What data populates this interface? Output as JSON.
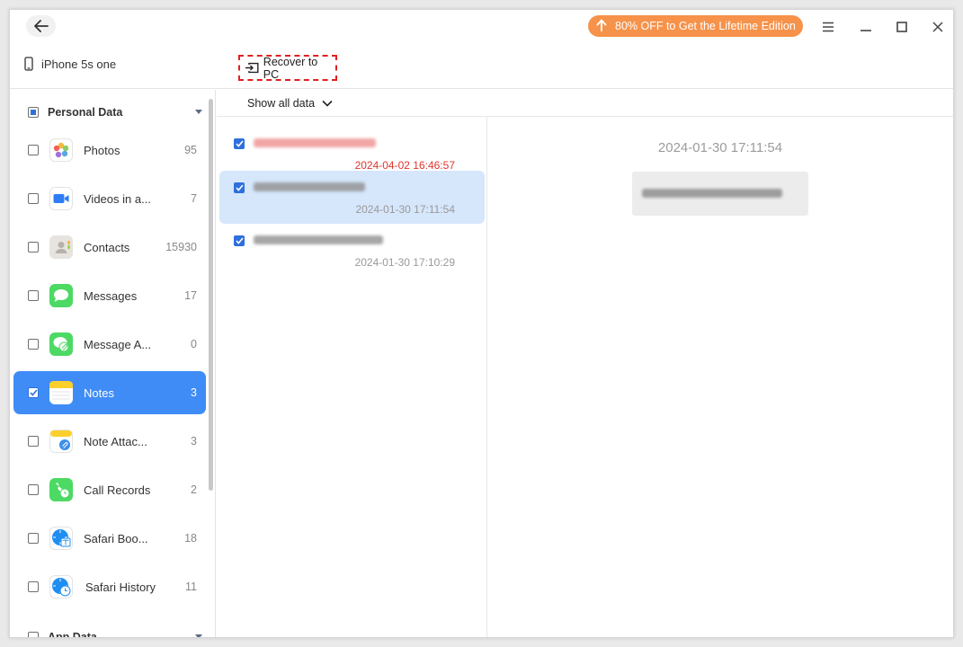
{
  "header": {
    "promo_label": "80% OFF to Get the Lifetime Edition",
    "device_name": "iPhone 5s one",
    "recover_label": "Recover to PC",
    "promo_color": "#f7924a"
  },
  "sidebar": {
    "group_personal": "Personal Data",
    "group_app": "App Data",
    "items": [
      {
        "name": "Photos",
        "count": "95",
        "icon": "photos-icon"
      },
      {
        "name": "Videos in a...",
        "count": "7",
        "icon": "videos-icon"
      },
      {
        "name": "Contacts",
        "count": "15930",
        "icon": "contacts-icon"
      },
      {
        "name": "Messages",
        "count": "17",
        "icon": "messages-icon"
      },
      {
        "name": "Message A...",
        "count": "0",
        "icon": "message-attachments-icon"
      },
      {
        "name": "Notes",
        "count": "3",
        "icon": "notes-icon"
      },
      {
        "name": "Note Attac...",
        "count": "3",
        "icon": "note-attachments-icon"
      },
      {
        "name": "Call Records",
        "count": "2",
        "icon": "call-records-icon"
      },
      {
        "name": "Safari Boo...",
        "count": "18",
        "icon": "safari-bookmarks-icon"
      },
      {
        "name": "Safari History",
        "count": "11",
        "icon": "safari-history-icon"
      }
    ],
    "active_color": "#3f8cf7"
  },
  "list": {
    "filter_label": "Show all data",
    "notes": [
      {
        "time": "2024-04-02 16:46:57"
      },
      {
        "time": "2024-01-30 17:11:54"
      },
      {
        "time": "2024-01-30 17:10:29"
      }
    ]
  },
  "detail": {
    "time": "2024-01-30 17:11:54"
  }
}
